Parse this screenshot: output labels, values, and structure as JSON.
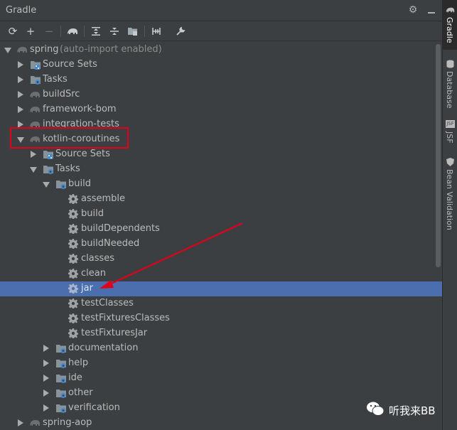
{
  "panel": {
    "title": "Gradle"
  },
  "titlebar_icons": [
    "gear-icon",
    "minimize-icon"
  ],
  "toolbar": {
    "buttons": [
      "refresh-icon",
      "add-icon",
      "remove-icon",
      "gradle-elephant-icon",
      "expand-all-icon",
      "collapse-all-icon",
      "group-modules-icon",
      "toggle-offline-icon",
      "settings-wrench-icon"
    ]
  },
  "tree": {
    "root": {
      "label": "spring",
      "suffix": "(auto-import enabled)"
    },
    "items": [
      {
        "label": "Source Sets"
      },
      {
        "label": "Tasks"
      },
      {
        "label": "buildSrc"
      },
      {
        "label": "framework-bom"
      },
      {
        "label": "integration-tests"
      },
      {
        "label": "kotlin-coroutines"
      },
      {
        "label": "Source Sets"
      },
      {
        "label": "Tasks"
      },
      {
        "label": "build"
      },
      {
        "label": "assemble"
      },
      {
        "label": "build"
      },
      {
        "label": "buildDependents"
      },
      {
        "label": "buildNeeded"
      },
      {
        "label": "classes"
      },
      {
        "label": "clean"
      },
      {
        "label": "jar"
      },
      {
        "label": "testClasses"
      },
      {
        "label": "testFixturesClasses"
      },
      {
        "label": "testFixturesJar"
      },
      {
        "label": "documentation"
      },
      {
        "label": "help"
      },
      {
        "label": "ide"
      },
      {
        "label": "other"
      },
      {
        "label": "verification"
      },
      {
        "label": "spring-aop"
      }
    ]
  },
  "side_tabs": [
    {
      "label": "Gradle"
    },
    {
      "label": "Database"
    },
    {
      "label": "JSF"
    },
    {
      "label": "Bean Validation"
    }
  ],
  "watermark": {
    "text": "听我来BB"
  },
  "colors": {
    "selection": "#4b6eaf",
    "highlight_box": "#e0001a",
    "arrow": "#e0001a"
  }
}
